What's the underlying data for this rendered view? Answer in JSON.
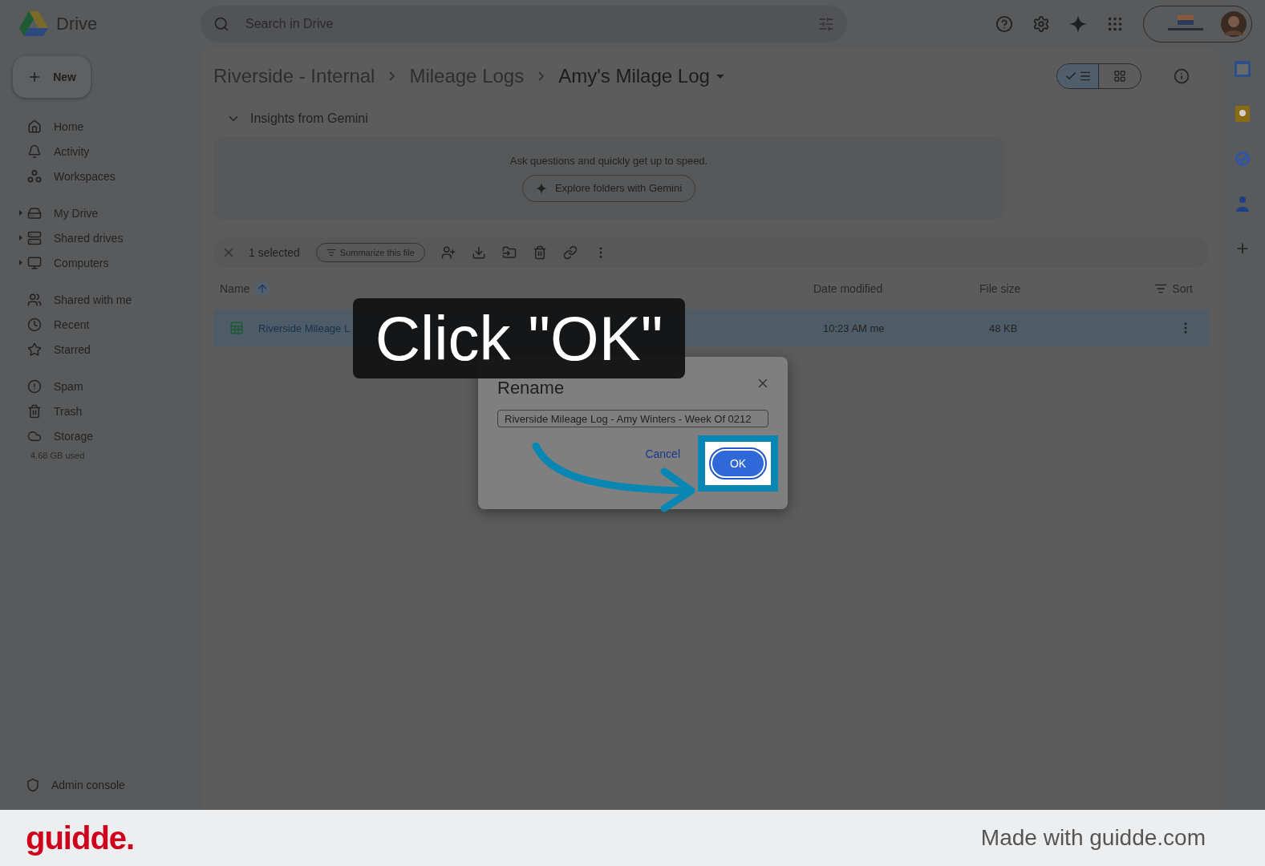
{
  "top_bar": {
    "app_name": "Drive",
    "search_placeholder": "Search in Drive"
  },
  "new_button": "New",
  "nav_sections": [
    {
      "items": [
        {
          "label": "Home",
          "expandable": false
        },
        {
          "label": "Activity",
          "expandable": false
        },
        {
          "label": "Workspaces",
          "expandable": false
        }
      ]
    },
    {
      "items": [
        {
          "label": "My Drive",
          "expandable": true
        },
        {
          "label": "Shared drives",
          "expandable": true
        },
        {
          "label": "Computers",
          "expandable": true
        }
      ]
    },
    {
      "items": [
        {
          "label": "Shared with me",
          "expandable": false
        },
        {
          "label": "Recent",
          "expandable": false
        },
        {
          "label": "Starred",
          "expandable": false
        }
      ]
    },
    {
      "items": [
        {
          "label": "Spam",
          "expandable": false
        },
        {
          "label": "Trash",
          "expandable": false
        },
        {
          "label": "Storage",
          "expandable": false
        }
      ]
    }
  ],
  "storage_used": "4.68 GB used",
  "admin_console": "Admin console",
  "breadcrumb": [
    {
      "label": "Riverside - Internal",
      "current": false
    },
    {
      "label": "Mileage Logs",
      "current": false
    },
    {
      "label": "Amy's Milage Log",
      "current": true
    }
  ],
  "view_toggle": [
    {
      "kind": "list",
      "selected": true
    },
    {
      "kind": "grid",
      "selected": false
    }
  ],
  "gemini": {
    "title": "Insights from Gemini",
    "expanded": true,
    "text": "Ask questions and quickly get up to speed.",
    "button": "Explore folders with Gemini"
  },
  "selection_bar": {
    "count": "1 selected",
    "summarize": "Summarize this file"
  },
  "table": {
    "columns": [
      "Name",
      "Date modified",
      "File size"
    ],
    "sort": "Sort",
    "rows": [
      {
        "name": "Riverside Mileage L",
        "date": "10:23 AM me",
        "size": "48 KB",
        "selected": true
      }
    ]
  },
  "dialog": {
    "title": "Rename",
    "value": "Riverside Mileage Log - Amy Winters - Week Of 0212",
    "cancel": "Cancel",
    "ok": "OK"
  },
  "callout": "Click \"OK\"",
  "footer": {
    "logo": "guidde.",
    "credit": "Made with guidde.com"
  }
}
